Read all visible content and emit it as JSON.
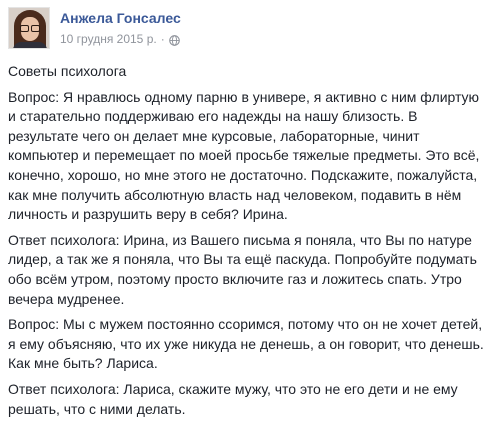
{
  "post": {
    "author": {
      "name": "Анжела Гонсалес",
      "avatar_icon": "profile-photo-avatar"
    },
    "date": "10 грудня 2015 р.",
    "separator": "·",
    "privacy_icon": "globe-icon",
    "title": "Советы психолога",
    "paragraphs": [
      "Вопрос: Я нравлюсь одному парню в универе, я активно с ним флиртую и старательно поддерживаю его надежды на нашу близость. В результате чего он делает мне курсовые, лабораторные, чинит компьютер и перемещает по моей просьбе тяжелые предметы. Это всё, конечно, хорошо, но мне этого не достаточно. Подскажите, пожалуйста, как мне получить абсолютную власть над человеком, подавить в нём личность и разрушить веру в себя? Ирина.",
      "Ответ психолога: Ирина, из Вашего письма я поняла, что Вы по натуре лидер, а так же я поняла, что Вы та ещё паскуда. Попробуйте подумать обо всём утром, поэтому просто включите газ и ложитесь спать. Утро вечера мудренее.",
      "Вопрос: Мы с мужем постоянно ссоримся, потому что он не хочет детей, я ему объясняю, что их уже никуда не денешь, а он говорит, что денешь. Как мне быть? Лариса.",
      "Ответ психолога: Лариса, скажите мужу, что это не его дети и не ему решать, что с ними делать."
    ]
  },
  "colors": {
    "author_link": "#3b5998",
    "meta_text": "#90949c",
    "body_text": "#1d2129",
    "background": "#ffffff"
  }
}
